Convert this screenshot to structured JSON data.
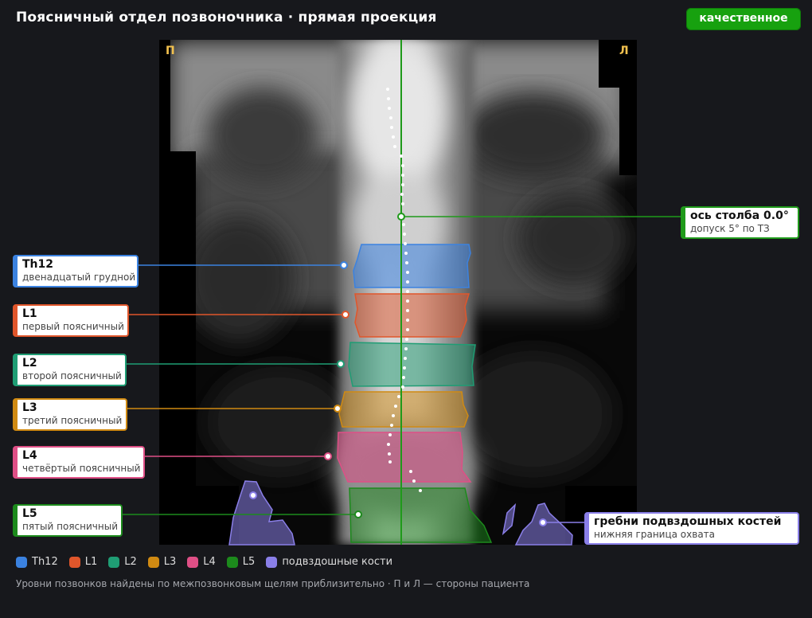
{
  "header": {
    "title": "Поясничный отдел позвоночника · прямая проекция",
    "badge": "качественное"
  },
  "scan": {
    "side_right_patient": "П",
    "side_left_patient": "Л"
  },
  "axis": {
    "name": "ось столба 0.0°",
    "desc": "допуск 5° по ТЗ",
    "color": "#1f9a1a"
  },
  "vertebrae": [
    {
      "id": "th12",
      "name": "Th12",
      "desc": "двенадцатый грудной",
      "color": "#3b82e0"
    },
    {
      "id": "l1",
      "name": "L1",
      "desc": "первый поясничный",
      "color": "#e0562b"
    },
    {
      "id": "l2",
      "name": "L2",
      "desc": "второй поясничный",
      "color": "#1f9d74"
    },
    {
      "id": "l3",
      "name": "L3",
      "desc": "третий поясничный",
      "color": "#d08a12"
    },
    {
      "id": "l4",
      "name": "L4",
      "desc": "четвёртый поясничный",
      "color": "#df4f86"
    },
    {
      "id": "l5",
      "name": "L5",
      "desc": "пятый поясничный",
      "color": "#1c8a1c"
    }
  ],
  "iliac": {
    "name": "гребни подвздошных костей",
    "desc": "нижняя граница охвата",
    "color": "#8a7fe8"
  },
  "legend": {
    "items": [
      {
        "label": "Th12",
        "color": "#3b82e0"
      },
      {
        "label": "L1",
        "color": "#e0562b"
      },
      {
        "label": "L2",
        "color": "#1f9d74"
      },
      {
        "label": "L3",
        "color": "#d08a12"
      },
      {
        "label": "L4",
        "color": "#df4f86"
      },
      {
        "label": "L5",
        "color": "#1c8a1c"
      },
      {
        "label": "подвздошные кости",
        "color": "#8a7fe8"
      }
    ]
  },
  "footnote": "Уровни позвонков найдены по межпозвонковым щелям приблизительно · П и Л — стороны пациента"
}
